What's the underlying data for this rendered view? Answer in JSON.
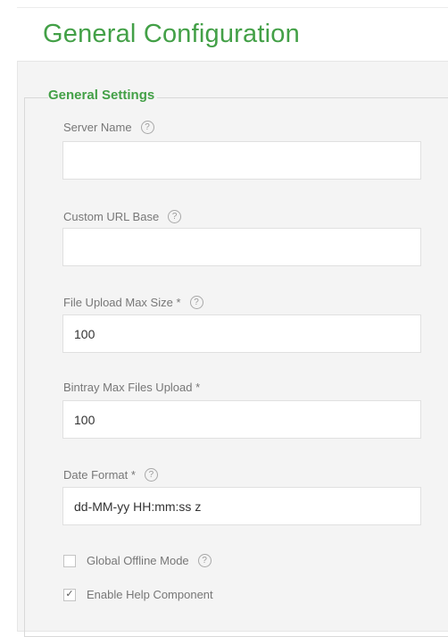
{
  "page": {
    "title": "General Configuration"
  },
  "section": {
    "legend": "General Settings"
  },
  "fields": {
    "server_name": {
      "label": "Server Name",
      "value": "",
      "help_icon": "question-circle-icon"
    },
    "custom_url_base": {
      "label": "Custom URL Base",
      "value": "",
      "help_icon": "question-circle-icon"
    },
    "file_upload_max_size": {
      "label": "File Upload Max Size *",
      "value": "100",
      "help_icon": "question-circle-icon"
    },
    "bintray_max_files_upload": {
      "label": "Bintray Max Files Upload *",
      "value": "100"
    },
    "date_format": {
      "label": "Date Format *",
      "value": "dd-MM-yy HH:mm:ss z",
      "help_icon": "question-circle-icon"
    }
  },
  "checkboxes": {
    "global_offline_mode": {
      "label": "Global Offline Mode",
      "checked": false,
      "help_icon": "question-circle-icon"
    },
    "enable_help_component": {
      "label": "Enable Help Component",
      "checked": true
    }
  },
  "icons": {
    "help_glyph": "?",
    "check_glyph": "✓"
  },
  "colors": {
    "accent": "#43a047",
    "label": "#777777",
    "panel_bg": "#f4f4f4"
  }
}
